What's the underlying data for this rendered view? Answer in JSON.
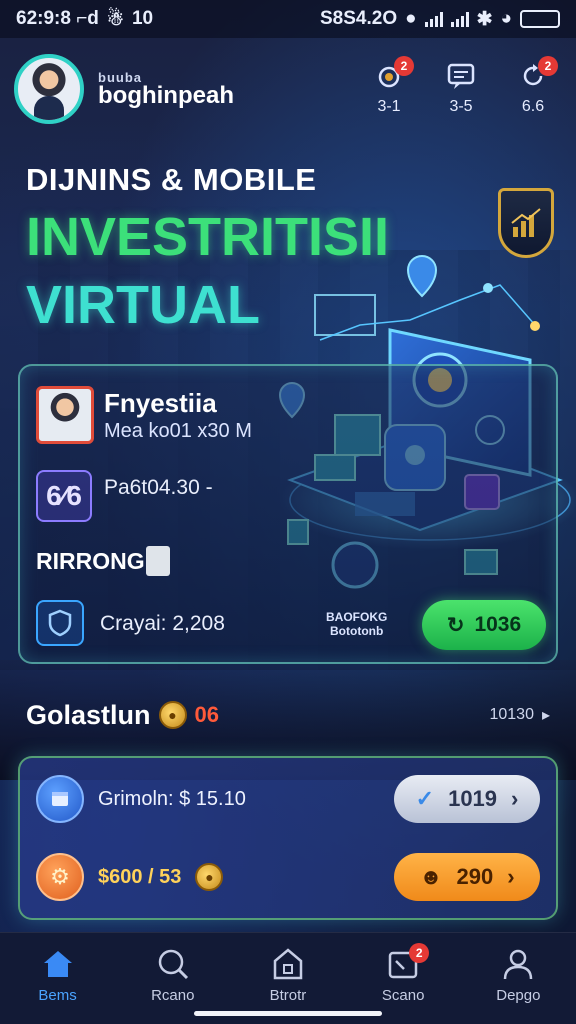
{
  "status_bar": {
    "time": "62:9:8 ⌐d",
    "extra": "10",
    "right_text": "S8S4.2O"
  },
  "header": {
    "brand_small": "buuba",
    "brand_name": "boghinpeah",
    "icons": [
      {
        "name": "eye-alert-icon",
        "label": "3-1",
        "badge": "2"
      },
      {
        "name": "chat-icon",
        "label": "3-5",
        "badge": ""
      },
      {
        "name": "refresh-icon",
        "label": "6.6",
        "badge": "2"
      }
    ]
  },
  "hero": {
    "subtitle": "DIJNINS & MOBILE",
    "title_line1": "INVESTRITISII",
    "title_line2": "VIRTUAL"
  },
  "card": {
    "title": "Fnyestiia",
    "subtitle": "Mea ko01 x30 M",
    "number_box": "6⁄6",
    "number_text": "Pa6t04.30 -",
    "label": "RIRRONG",
    "crayal": "Crayai: 2,208",
    "bao_line1": "BAOFOKG",
    "bao_line2": "Bototonb",
    "button_label": "1036"
  },
  "section": {
    "title": "Golastlun",
    "chip": "06",
    "see_all": "10130"
  },
  "panel": {
    "row1_text": "Grimoln: $ 15.10",
    "row1_button": "1019",
    "row2_text": "$600 / 53",
    "row2_button": "290"
  },
  "nav": [
    {
      "label": "Bems",
      "icon": "home-icon",
      "active": true,
      "badge": ""
    },
    {
      "label": "Rcano",
      "icon": "search-icon",
      "active": false,
      "badge": ""
    },
    {
      "label": "Btrotr",
      "icon": "store-icon",
      "active": false,
      "badge": ""
    },
    {
      "label": "Scano",
      "icon": "scan-icon",
      "active": false,
      "badge": "2"
    },
    {
      "label": "Depgo",
      "icon": "user-icon",
      "active": false,
      "badge": ""
    }
  ],
  "colors": {
    "accent_green": "#3ce07a",
    "accent_teal": "#3ee0d0",
    "nav_active": "#4aa3ff",
    "badge_red": "#e53935"
  }
}
